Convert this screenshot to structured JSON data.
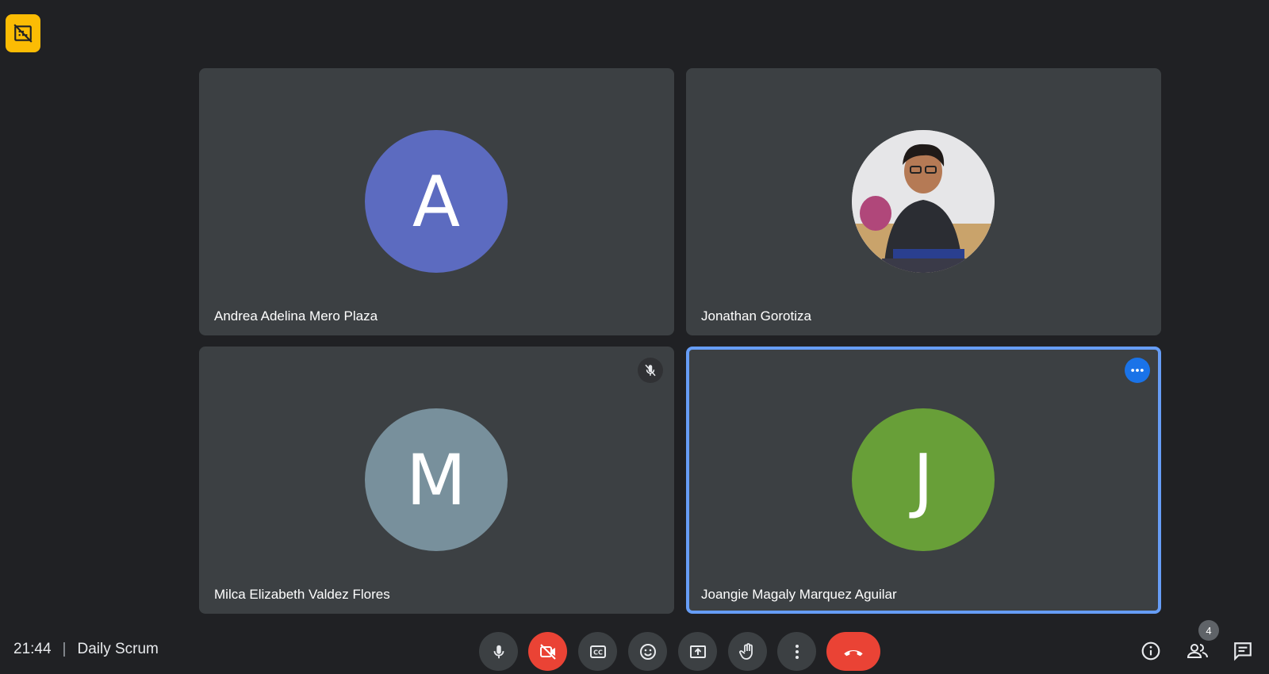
{
  "meeting": {
    "time": "21:44",
    "separator": "|",
    "title": "Daily Scrum"
  },
  "participants": [
    {
      "name": "Andrea Adelina Mero Plaza",
      "initial": "A",
      "avatar_color": "#5c6bc0",
      "muted": false,
      "active": false
    },
    {
      "name": "Jonathan Gorotiza",
      "initial": "",
      "avatar_type": "photo",
      "muted": false,
      "active": false
    },
    {
      "name": "Milca Elizabeth Valdez Flores",
      "initial": "M",
      "avatar_color": "#78909c",
      "muted": true,
      "active": false
    },
    {
      "name": "Joangie Magaly Marquez Aguilar",
      "initial": "J",
      "avatar_color": "#689f38",
      "muted": false,
      "active": true
    }
  ],
  "controls": {
    "icons": [
      "microphone-icon",
      "camera-off-icon",
      "captions-icon",
      "emoji-icon",
      "present-screen-icon",
      "raise-hand-icon",
      "more-options-icon",
      "end-call-icon"
    ],
    "right_icons": [
      "info-icon",
      "people-icon",
      "chat-icon"
    ],
    "people_count": "4"
  },
  "colors": {
    "background": "#202124",
    "tile": "#3c4043",
    "active_border": "#669df6",
    "danger": "#ea4335",
    "badge": "#fbbc04",
    "accent": "#1a73e8"
  }
}
